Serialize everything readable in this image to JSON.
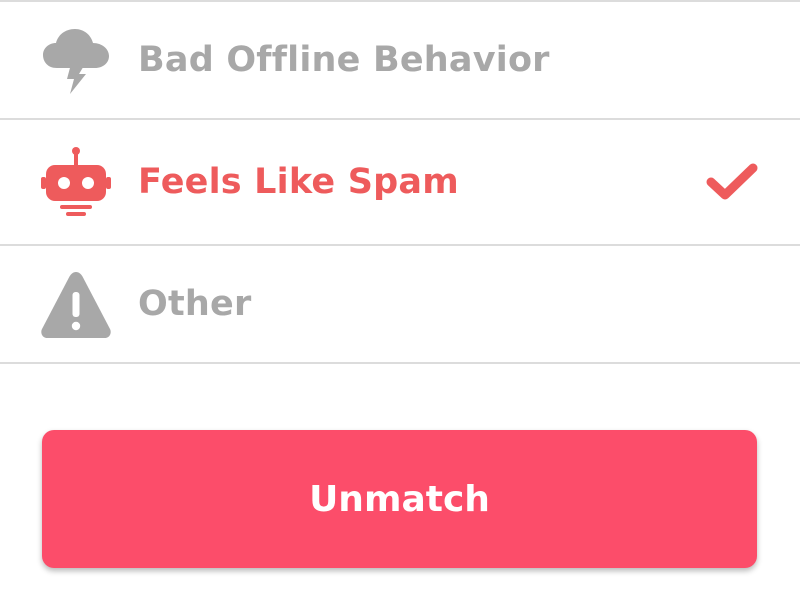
{
  "colors": {
    "muted": "#a8a8a8",
    "accent": "#ee5b5c",
    "button": "#fc4d6a",
    "divider": "#dcdcdc"
  },
  "options": [
    {
      "label": "Bad Offline Behavior",
      "icon": "storm-cloud-icon",
      "selected": false
    },
    {
      "label": "Feels Like Spam",
      "icon": "robot-icon",
      "selected": true
    },
    {
      "label": "Other",
      "icon": "warning-icon",
      "selected": false
    }
  ],
  "selected_indicator_icon": "checkmark-icon",
  "primary_button": {
    "label": "Unmatch"
  }
}
